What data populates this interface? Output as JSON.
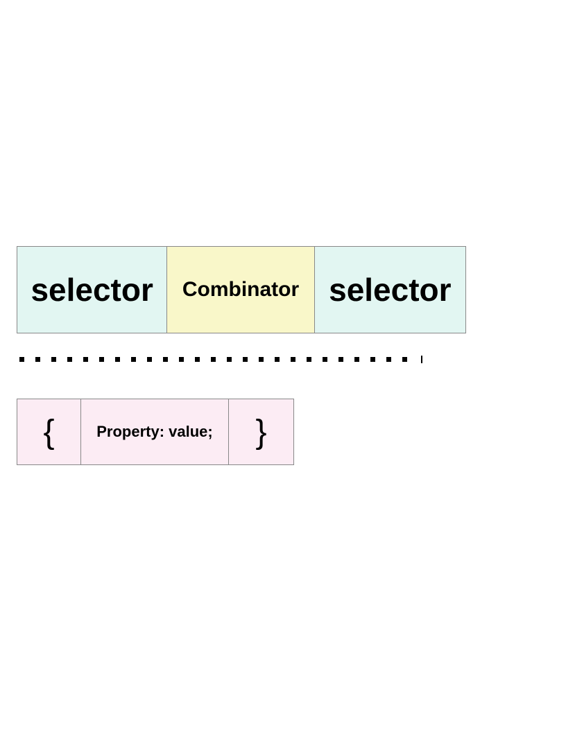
{
  "row1": {
    "selector_left": "selector",
    "combinator": "Combinator",
    "selector_right": "selector"
  },
  "row2": {
    "open_brace": "{",
    "declaration": "Property: value;",
    "close_brace": "}"
  }
}
